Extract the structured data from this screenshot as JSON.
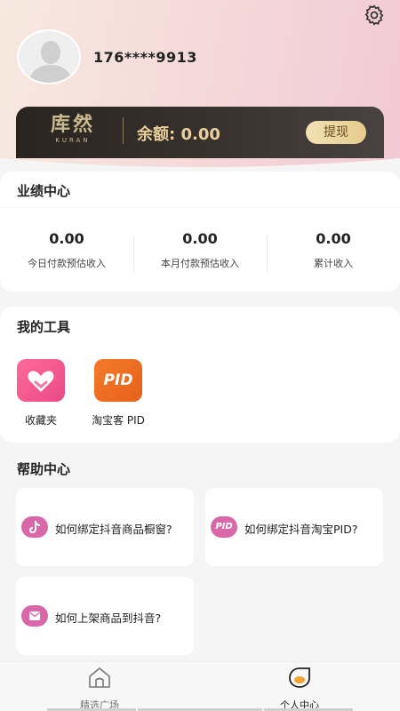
{
  "header": {
    "phone": "176****9913",
    "settings_icon": "gear-icon"
  },
  "balance_card": {
    "brand_cn": "库然",
    "brand_en": "KURAN",
    "balance_label": "余额: 0.00",
    "withdraw_label": "提现"
  },
  "performance": {
    "title": "业绩中心",
    "stats": [
      {
        "value": "0.00",
        "label": "今日付款预估收入"
      },
      {
        "value": "0.00",
        "label": "本月付款预估收入"
      },
      {
        "value": "0.00",
        "label": "累计收入"
      }
    ]
  },
  "tools": {
    "title": "我的工具",
    "items": [
      {
        "label": "收藏夹",
        "icon": "heart-icon",
        "color": "#ef4f86"
      },
      {
        "label": "淘宝客 PID",
        "icon_text": "PID",
        "icon": "pid-icon",
        "color": "#ee6c1f"
      }
    ]
  },
  "help": {
    "title": "帮助中心",
    "items": [
      {
        "text": "如何绑定抖音商品橱窗?",
        "icon": "tiktok-icon"
      },
      {
        "text": "如何绑定抖音淘宝PID?",
        "icon_text": "PID",
        "icon": "pid-icon"
      },
      {
        "text": "如何上架商品到抖音?",
        "icon": "mail-icon"
      }
    ]
  },
  "tabbar": {
    "items": [
      {
        "label": "精选广场",
        "icon": "home-icon",
        "active": false
      },
      {
        "label": "个人中心",
        "icon": "profile-icon",
        "active": true
      }
    ]
  },
  "colors": {
    "accent_pink": "#d868a8",
    "card_dark": "#2a2421",
    "gold": "#e8cf9c"
  }
}
